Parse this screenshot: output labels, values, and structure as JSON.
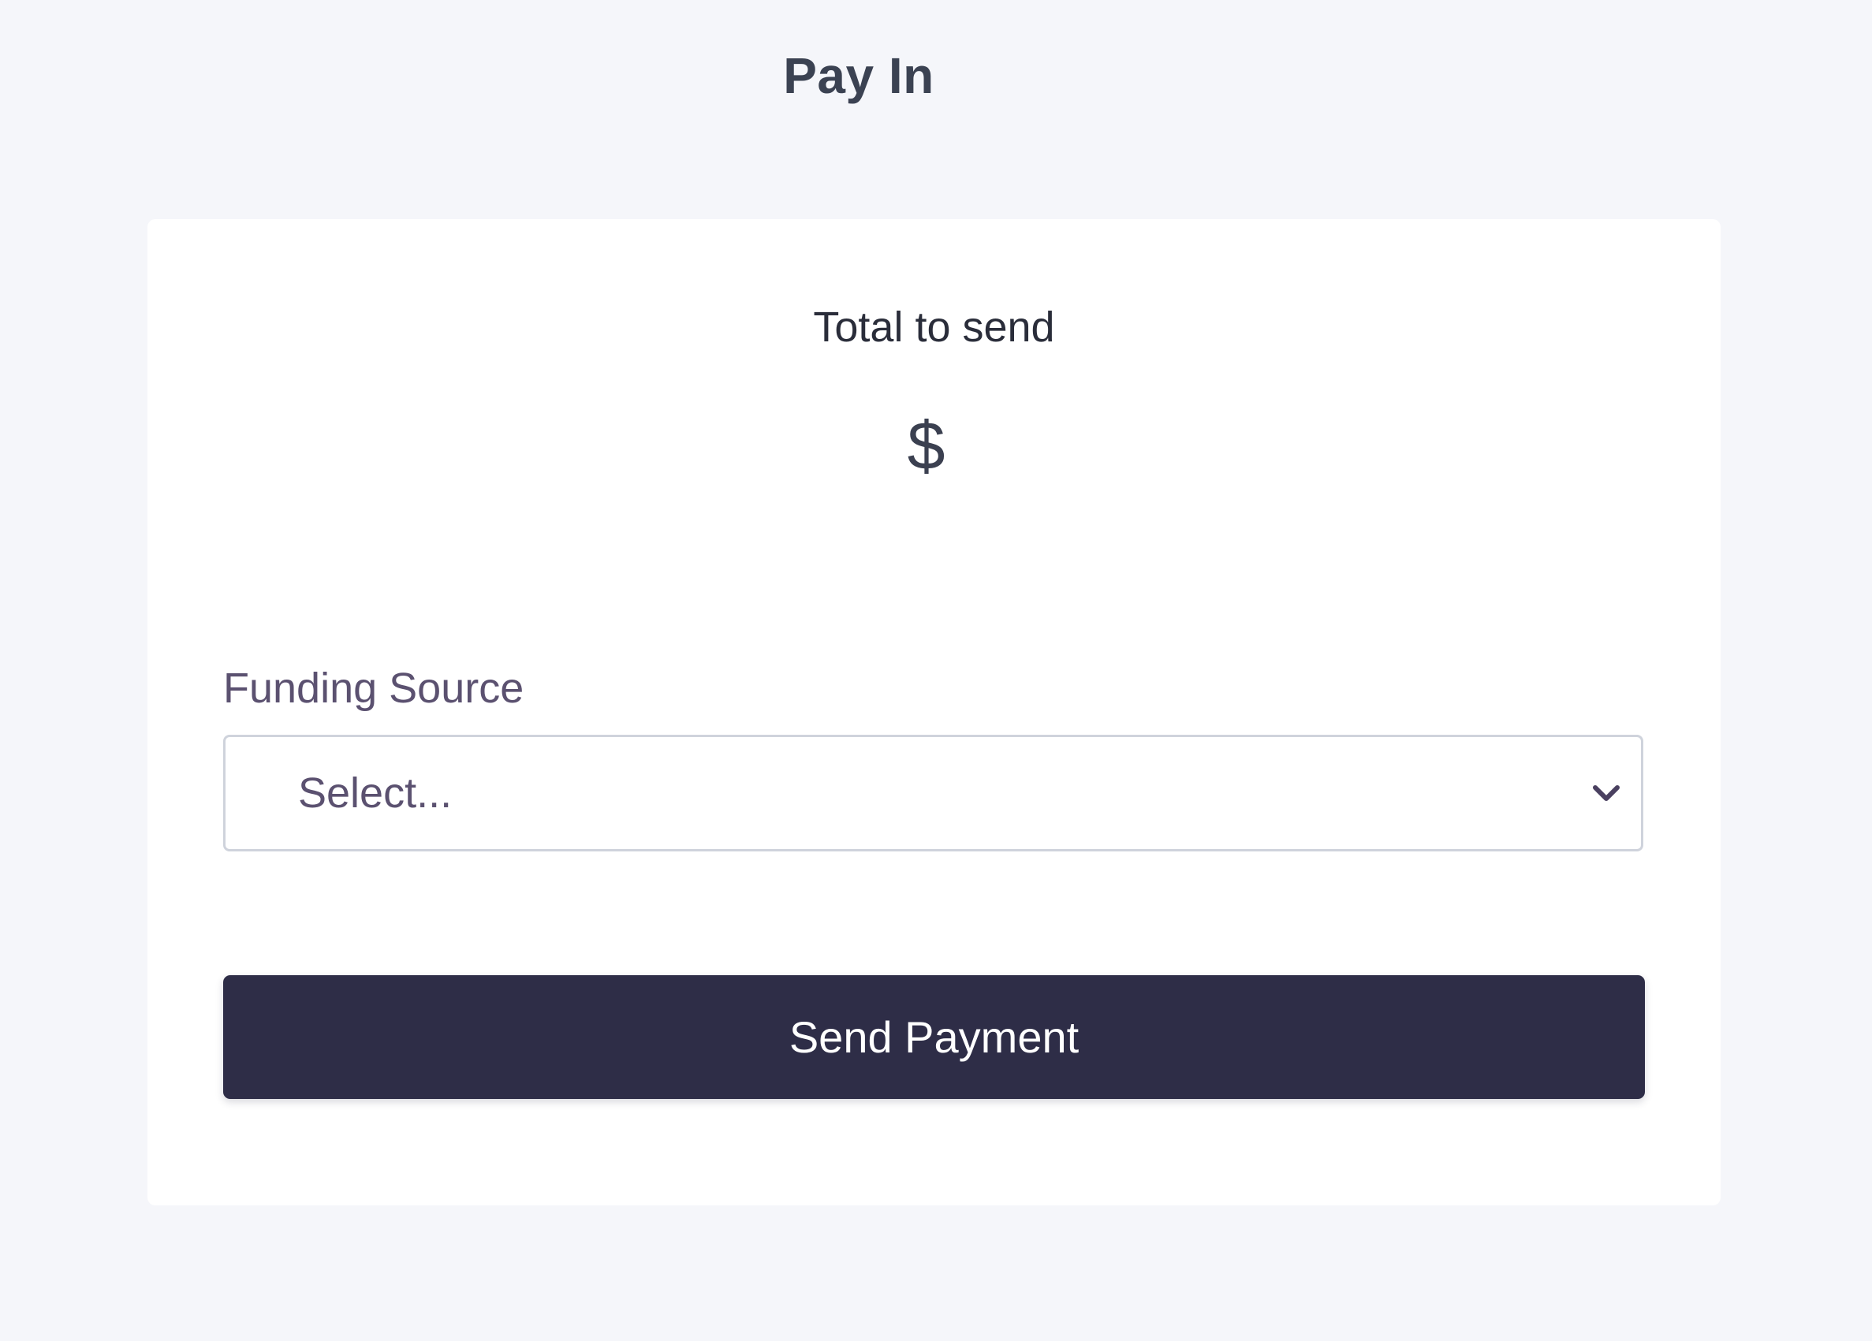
{
  "header": {
    "title": "Pay In"
  },
  "summary": {
    "total_label": "Total to send",
    "currency_symbol": "$"
  },
  "funding": {
    "label": "Funding Source",
    "selected_value": "Select..."
  },
  "actions": {
    "send_label": "Send Payment"
  },
  "icons": {
    "dropdown": "chevron-down-icon"
  },
  "colors": {
    "background": "#f5f6fa",
    "card": "#ffffff",
    "primary_button": "#2e2d47",
    "label_text": "#5b5170",
    "title_text": "#3b4252"
  }
}
